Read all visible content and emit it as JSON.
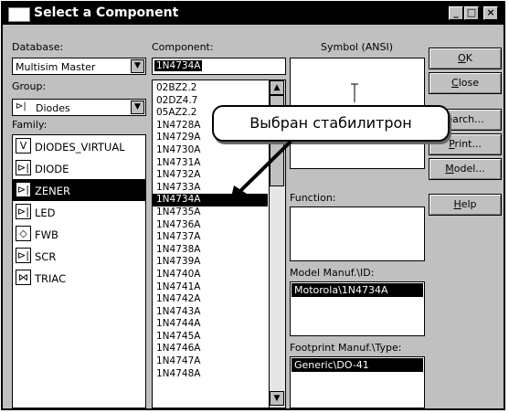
{
  "window": {
    "title": "Select a Component",
    "controls": [
      "_",
      "□",
      "×"
    ]
  },
  "database": {
    "label": "Database:",
    "value": "Multisim Master"
  },
  "group": {
    "label": "Group:",
    "value": "Diodes",
    "icon": "diode-icon"
  },
  "family": {
    "label": "Family:",
    "items": [
      {
        "label": "DIODES_VIRTUAL",
        "icon": "virtual-diode-icon",
        "glyph": "V",
        "selected": false
      },
      {
        "label": "DIODE",
        "icon": "diode-icon",
        "glyph": "⊳|",
        "selected": false
      },
      {
        "label": "ZENER",
        "icon": "zener-icon",
        "glyph": "⊳|",
        "selected": true
      },
      {
        "label": "LED",
        "icon": "led-icon",
        "glyph": "⊳|",
        "selected": false
      },
      {
        "label": "FWB",
        "icon": "bridge-rectifier-icon",
        "glyph": "◇",
        "selected": false
      },
      {
        "label": "SCR",
        "icon": "scr-icon",
        "glyph": "⊳|",
        "selected": false
      },
      {
        "label": "TRIAC",
        "icon": "triac-icon",
        "glyph": "⋈",
        "selected": false
      }
    ]
  },
  "component": {
    "label": "Component:",
    "input_value": "1N4734A",
    "selected": "1N4734A",
    "items": [
      "02BZ2.2",
      "02DZ4.7",
      "05AZ2.2",
      "1N4728A",
      "1N4729A",
      "1N4730A",
      "1N4731A",
      "1N4732A",
      "1N4733A",
      "1N4734A",
      "1N4735A",
      "1N4736A",
      "1N4737A",
      "1N4738A",
      "1N4739A",
      "1N4740A",
      "1N4741A",
      "1N4742A",
      "1N4743A",
      "1N4744A",
      "1N4745A",
      "1N4746A",
      "1N4747A",
      "1N4748A"
    ]
  },
  "symbol": {
    "label": "Symbol (ANSI)"
  },
  "function": {
    "label": "Function:"
  },
  "model_manuf": {
    "label": "Model Manuf.\\ID:",
    "value": "Motorola\\1N4734A"
  },
  "footprint_manuf": {
    "label": "Footprint Manuf.\\Type:",
    "value": "Generic\\DO-41"
  },
  "buttons": {
    "ok": {
      "label": "OK",
      "mnemonic": "O",
      "rest": "K"
    },
    "close": {
      "label": "Close",
      "mnemonic": "C",
      "rest": "lose"
    },
    "search": {
      "label": "Search...",
      "visible": "earch..."
    },
    "print": {
      "label": "Print...",
      "mnemonic": "P",
      "rest": "rint..."
    },
    "model": {
      "label": "Model...",
      "mnemonic": "M",
      "rest": "odel..."
    },
    "help": {
      "label": "Help",
      "mnemonic": "H",
      "rest": "elp"
    }
  },
  "callout": {
    "text": "Выбран стабилитрон"
  }
}
